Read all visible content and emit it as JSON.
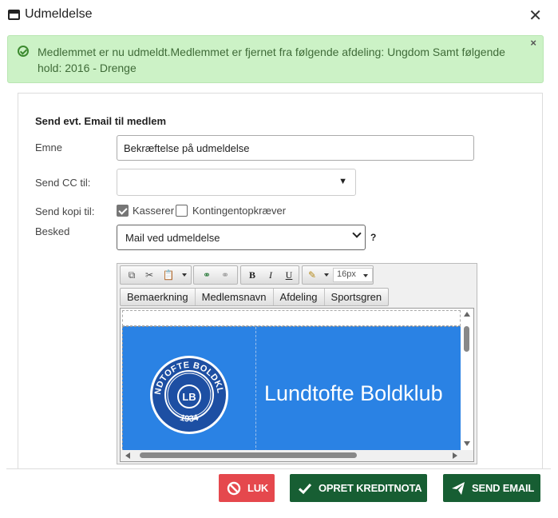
{
  "dialog": {
    "title": "Udmeldelse"
  },
  "alert": {
    "message": "Medlemmet er nu udmeldt.Medlemmet er fjernet fra følgende afdeling: Ungdom Samt følgende hold: 2016 - Drenge",
    "close_label": "×"
  },
  "form": {
    "section_title": "Send evt. Email til medlem",
    "subject_label": "Emne",
    "subject_value": "Bekræftelse på udmeldelse",
    "cc_label": "Send CC til:",
    "cc_value": "",
    "copy_label": "Send kopi til:",
    "copy_options": [
      {
        "label": "Kasserer",
        "checked": true
      },
      {
        "label": "Kontingentopkræver",
        "checked": false
      }
    ],
    "message_label": "Besked",
    "message_value": "Mail ved udmeldelse",
    "help_label": "?"
  },
  "editor": {
    "font_size": "16px",
    "insert_buttons": [
      "Bemaerkning",
      "Medlemsnavn",
      "Afdeling",
      "Sportsgren"
    ],
    "bold": "B",
    "italic": "I",
    "underline": "U"
  },
  "banner": {
    "club_name": "Lundtofte Boldklub",
    "logo_ring_text": "LUNDTOFTE BOLDKLUB",
    "logo_initials": "LB",
    "logo_year": "1934",
    "color": "#2a82e4"
  },
  "footer": {
    "close_label": "LUK",
    "credit_note_label": "OPRET KREDITNOTA",
    "send_email_label": "SEND EMAIL"
  },
  "colors": {
    "alert_bg": "#ccf2c6",
    "danger": "#e5484d",
    "primary": "#175e33"
  }
}
